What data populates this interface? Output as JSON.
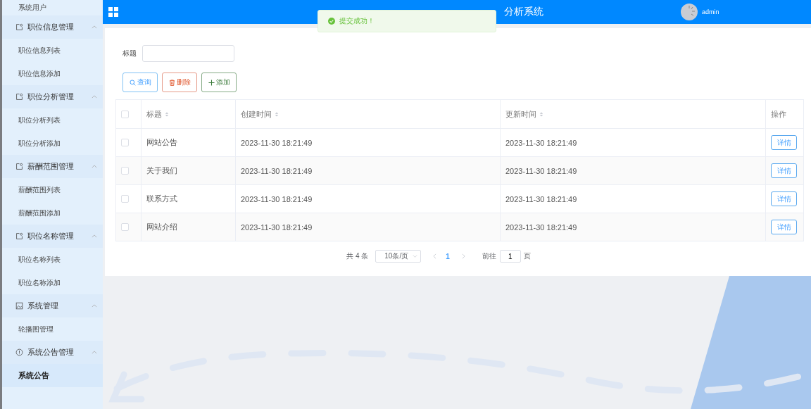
{
  "sidebar": {
    "items": [
      {
        "label": "系统用户",
        "kind": "item",
        "selected": false
      },
      {
        "label": "职位信息管理",
        "kind": "doc-group",
        "expanded": true
      },
      {
        "label": "职位信息列表",
        "kind": "item",
        "selected": false
      },
      {
        "label": "职位信息添加",
        "kind": "item",
        "selected": false
      },
      {
        "label": "职位分析管理",
        "kind": "doc-group",
        "expanded": true
      },
      {
        "label": "职位分析列表",
        "kind": "item",
        "selected": false
      },
      {
        "label": "职位分析添加",
        "kind": "item",
        "selected": false
      },
      {
        "label": "薪酬范围管理",
        "kind": "doc-group",
        "expanded": true
      },
      {
        "label": "薪酬范围列表",
        "kind": "item",
        "selected": false
      },
      {
        "label": "薪酬范围添加",
        "kind": "item",
        "selected": false
      },
      {
        "label": "职位名称管理",
        "kind": "doc-group",
        "expanded": true
      },
      {
        "label": "职位名称列表",
        "kind": "item",
        "selected": false
      },
      {
        "label": "职位名称添加",
        "kind": "item",
        "selected": false
      },
      {
        "label": "系统管理",
        "kind": "image-group",
        "expanded": true
      },
      {
        "label": "轮播图管理",
        "kind": "item",
        "selected": false
      },
      {
        "label": "系统公告管理",
        "kind": "info-group",
        "expanded": true
      },
      {
        "label": "系统公告",
        "kind": "item",
        "selected": true
      }
    ]
  },
  "header": {
    "title": "分析系统",
    "user": "admin"
  },
  "toast": {
    "message": "提交成功！"
  },
  "search": {
    "label": "标题"
  },
  "buttons": [
    {
      "label": "查询",
      "kind": "search"
    },
    {
      "label": "删除",
      "kind": "delete"
    },
    {
      "label": "添加",
      "kind": "add"
    }
  ],
  "table": {
    "select_all_checked": false,
    "columns": [
      {
        "label": "标题",
        "sortable": true
      },
      {
        "label": "创建时间",
        "sortable": true
      },
      {
        "label": "更新时间",
        "sortable": true
      },
      {
        "label": "操作",
        "sortable": false
      }
    ],
    "rows": [
      {
        "checked": false,
        "title": "网站公告",
        "created": "2023-11-30 18:21:49",
        "updated": "2023-11-30 18:21:49",
        "action": "详情"
      },
      {
        "checked": false,
        "title": "关于我们",
        "created": "2023-11-30 18:21:49",
        "updated": "2023-11-30 18:21:49",
        "action": "详情"
      },
      {
        "checked": false,
        "title": "联系方式",
        "created": "2023-11-30 18:21:49",
        "updated": "2023-11-30 18:21:49",
        "action": "详情"
      },
      {
        "checked": false,
        "title": "网站介绍",
        "created": "2023-11-30 18:21:49",
        "updated": "2023-11-30 18:21:49",
        "action": "详情"
      }
    ]
  },
  "pagination": {
    "total": "共 4 条",
    "page_size": "10条/页",
    "pages": [
      {
        "label": "1",
        "selected": true
      }
    ],
    "goto_label": "前往",
    "goto_value": "1",
    "page_label": "页"
  }
}
